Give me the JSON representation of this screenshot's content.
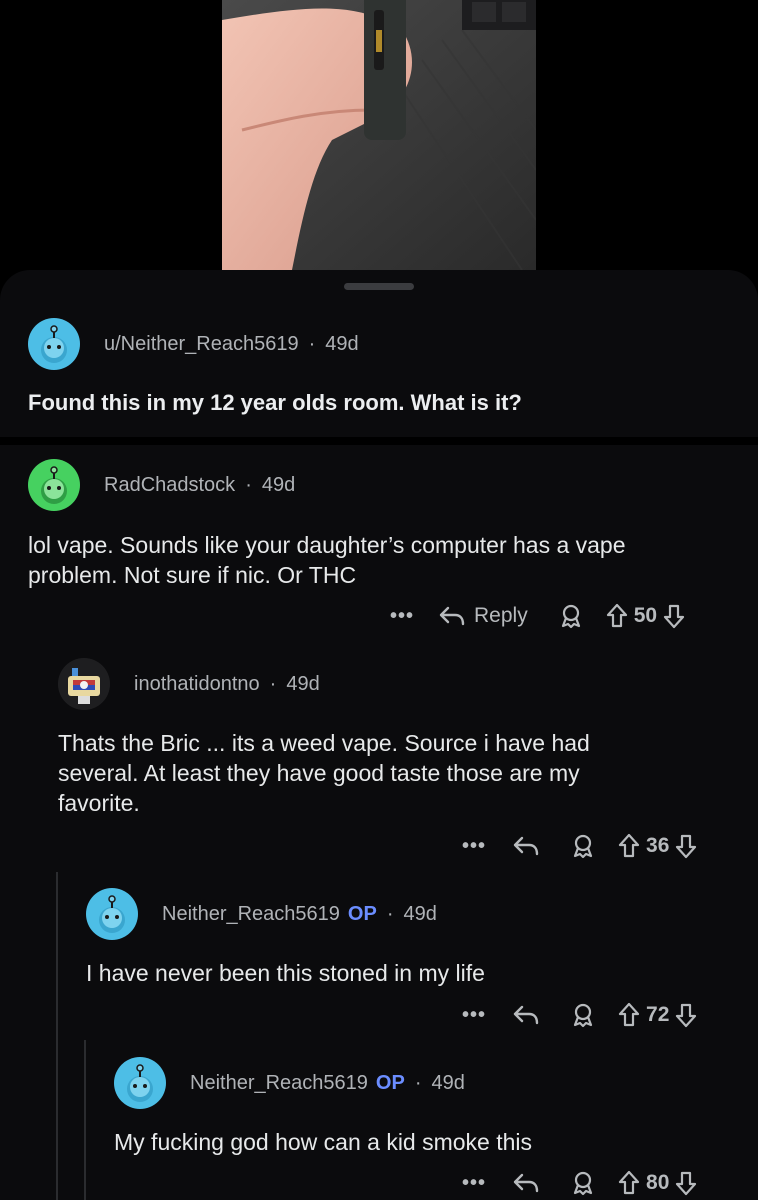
{
  "post": {
    "author": "u/Neither_Reach5619",
    "age": "49d",
    "title": "Found this in my 12 year olds room. What is it?"
  },
  "comments": [
    {
      "author": "RadChadstock",
      "age": "49d",
      "body_lines": [
        "lol vape. Sounds like your daughter’s computer has a vape",
        "problem. Not sure if nic. Or THC"
      ],
      "reply_label": "Reply",
      "votes": "50",
      "avatar_color": "#46d160"
    },
    {
      "author": "inothatidontno",
      "age": "49d",
      "body_lines": [
        "Thats the Bric ... its a weed vape. Source i have had",
        "several. At least they have good taste those are my",
        "favorite."
      ],
      "votes": "36"
    },
    {
      "author": "Neither_Reach5619",
      "op_badge": "OP",
      "age": "49d",
      "body_lines": [
        "I have never been this stoned in my life"
      ],
      "votes": "72",
      "avatar_color": "#4dbee6"
    },
    {
      "author": "Neither_Reach5619",
      "op_badge": "OP",
      "age": "49d",
      "body_lines": [
        "My fucking god how can a kid smoke this"
      ],
      "votes": "80",
      "avatar_color": "#4dbee6"
    }
  ],
  "icons": {
    "more": "•••",
    "reply": "reply-arrow-icon",
    "award": "award-icon",
    "upvote": "upvote-arrow-icon",
    "downvote": "downvote-arrow-icon"
  },
  "colors": {
    "background": "#0b0b0d",
    "op": "#6b8dff",
    "text": "#e7e9ea",
    "meta": "#b0b3b7"
  }
}
